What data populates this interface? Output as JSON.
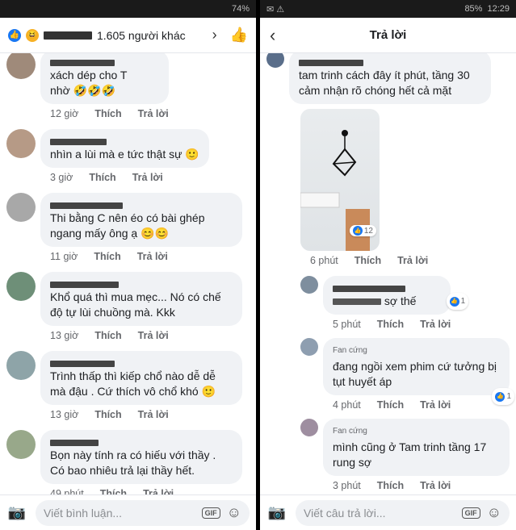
{
  "status_left": {
    "battery": "74%"
  },
  "status_right": {
    "battery": "85%",
    "time": "12:29"
  },
  "left": {
    "header": {
      "reaction_text": "1.605 người khác"
    },
    "comments": [
      {
        "text": "xách dép cho T",
        "time": "12 giờ",
        "like": "Thích",
        "reply": "Trả lời",
        "extra": "nhờ 🤣🤣🤣"
      },
      {
        "text": "nhìn a lùi mà e tức thật sự 🙂",
        "time": "3 giờ",
        "like": "Thích",
        "reply": "Trả lời"
      },
      {
        "text": "Thi bằng C nên éo có bài ghép ngang mấy ông ạ 😊😊",
        "time": "11 giờ",
        "like": "Thích",
        "reply": "Trả lời"
      },
      {
        "text": "Khổ quá thì mua mẹc... Nó có chế độ tự lùi chuồng mà. Kkk",
        "time": "13 giờ",
        "like": "Thích",
        "reply": "Trả lời"
      },
      {
        "text": "Trình thấp thì kiếp chổ nào dễ dễ mà đậu . Cứ thích vô chổ khó 🙂",
        "time": "13 giờ",
        "like": "Thích",
        "reply": "Trả lời"
      },
      {
        "text": "Bọn này tính ra có hiếu với thầy . Có bao nhiêu trả lại thầy hết.",
        "time": "49 phút",
        "like": "Thích",
        "reply": "Trả lời"
      }
    ],
    "footer": {
      "placeholder": "Viết bình luận...",
      "gif": "GIF"
    }
  },
  "right": {
    "header": {
      "title": "Trả lời"
    },
    "comments": [
      {
        "text": "tam trinh cách đây ít phút, tầng 30 cảm nhận rõ    chóng hết cả mặt",
        "time": "6 phút",
        "like": "Thích",
        "reply": "Trả lời",
        "reaction_count": "12"
      },
      {
        "text": "sợ thế",
        "time": "5 phút",
        "like": "Thích",
        "reply": "Trả lời",
        "reaction_count": "1"
      },
      {
        "badge": "Fan cứng",
        "text": "đang ngồi xem phim cứ tưởng bị tụt huyết áp",
        "time": "4 phút",
        "like": "Thích",
        "reply": "Trả lời",
        "reaction_count": "1"
      },
      {
        "badge": "Fan cứng",
        "text": "mình cũng ở Tam trinh tầng 17 rung sợ",
        "time": "3 phút",
        "like": "Thích",
        "reply": "Trả lời"
      }
    ],
    "footer": {
      "placeholder": "Viết câu trả lời...",
      "gif": "GIF"
    }
  }
}
